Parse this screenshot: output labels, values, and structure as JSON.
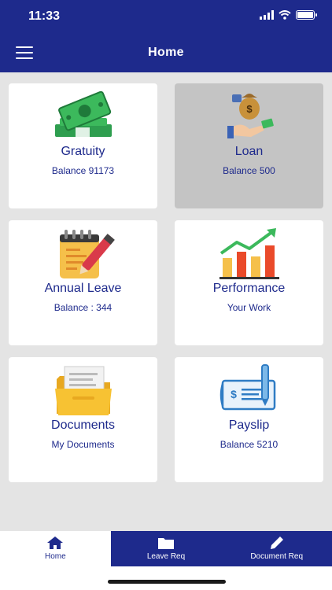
{
  "status_bar": {
    "time": "11:33"
  },
  "header": {
    "title": "Home"
  },
  "cards": [
    {
      "title": "Gratuity",
      "subtitle": "Balance 91173",
      "icon": "money-stack-icon"
    },
    {
      "title": "Loan",
      "subtitle": "Balance 500",
      "icon": "loan-hand-icon"
    },
    {
      "title": "Annual Leave",
      "subtitle": "Balance : 344",
      "icon": "notepad-pen-icon"
    },
    {
      "title": "Performance",
      "subtitle": "Your Work",
      "icon": "growth-chart-icon"
    },
    {
      "title": "Documents",
      "subtitle": "My Documents",
      "icon": "folder-icon"
    },
    {
      "title": "Payslip",
      "subtitle": "Balance 5210",
      "icon": "cheque-pen-icon"
    }
  ],
  "bottom_nav": [
    {
      "label": "Home",
      "icon": "home-icon",
      "active": true
    },
    {
      "label": "Leave Req",
      "icon": "folder-icon",
      "active": false
    },
    {
      "label": "Document Req",
      "icon": "pencil-icon",
      "active": false
    }
  ],
  "colors": {
    "primary": "#1e2a8c",
    "background": "#e4e4e4",
    "selected_card": "#c4c4c4"
  }
}
